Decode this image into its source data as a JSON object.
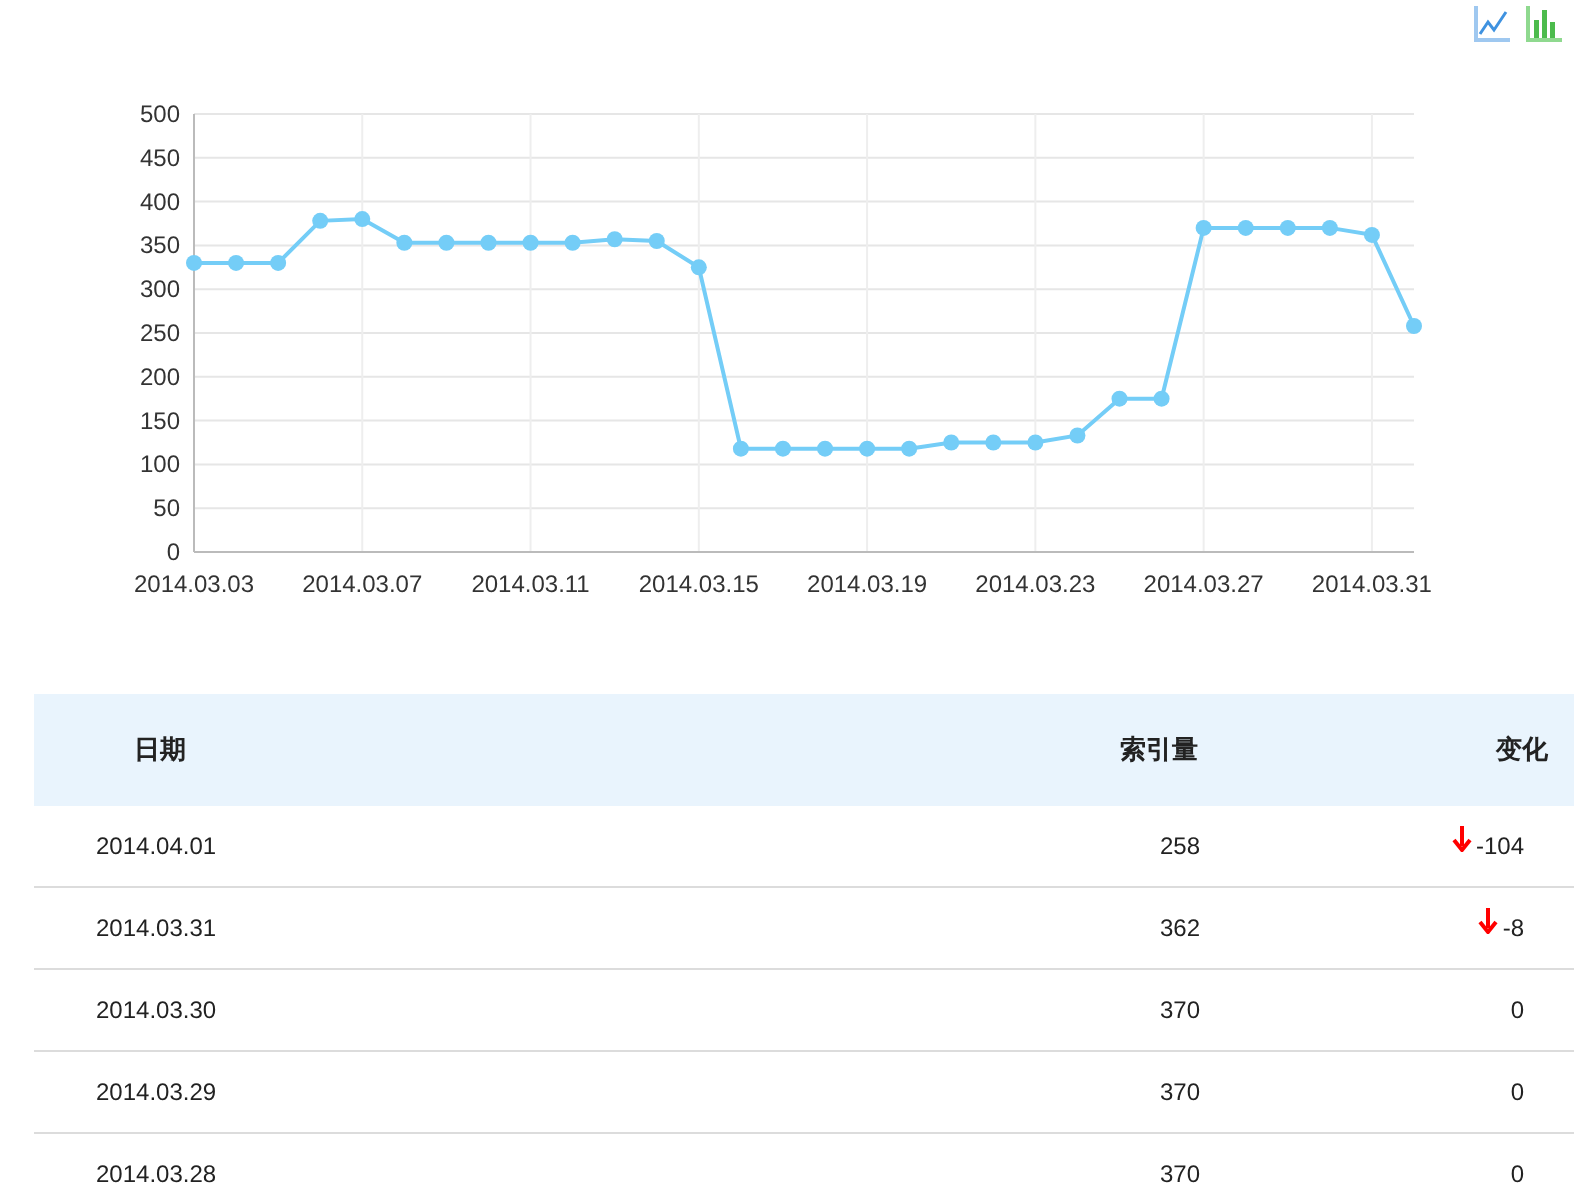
{
  "toolbar": {
    "buttons": [
      {
        "kind": "line"
      },
      {
        "kind": "bar"
      }
    ]
  },
  "chart": {
    "chart_data": {
      "type": "line",
      "grid": true,
      "categories": [
        "2014.03.03",
        null,
        null,
        null,
        "2014.03.07",
        null,
        null,
        null,
        "2014.03.11",
        null,
        null,
        null,
        "2014.03.15",
        null,
        null,
        null,
        "2014.03.19",
        null,
        null,
        null,
        "2014.03.23",
        null,
        null,
        null,
        "2014.03.27",
        null,
        null,
        null,
        "2014.03.31",
        null
      ],
      "series": [
        {
          "color": "#74cdf7",
          "marker": "circle",
          "values": [
            330,
            330,
            330,
            378,
            380,
            353,
            353,
            353,
            353,
            353,
            357,
            355,
            325,
            118,
            118,
            118,
            118,
            118,
            125,
            125,
            125,
            133,
            175,
            175,
            370,
            370,
            370,
            370,
            362,
            258
          ]
        }
      ],
      "ylim": [
        0,
        500
      ],
      "yticks": [
        0,
        50,
        100,
        150,
        200,
        250,
        300,
        350,
        400,
        450,
        500
      ]
    }
  },
  "table": {
    "columns": [
      "日期",
      "索引量",
      "变化"
    ],
    "rows": [
      {
        "date": "2014.04.01",
        "count": "258",
        "change": "-104",
        "kind": "down"
      },
      {
        "date": "2014.03.31",
        "count": "362",
        "change": "-8",
        "kind": "down"
      },
      {
        "date": "2014.03.30",
        "count": "370",
        "change": "0",
        "kind": "flat"
      },
      {
        "date": "2014.03.29",
        "count": "370",
        "change": "0",
        "kind": "flat"
      },
      {
        "date": "2014.03.28",
        "count": "370",
        "change": "0",
        "kind": "flat"
      }
    ]
  }
}
